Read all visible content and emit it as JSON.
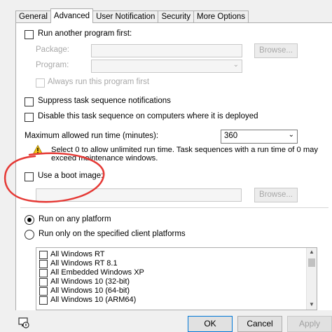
{
  "tabs": [
    "General",
    "Advanced",
    "User Notification",
    "Security",
    "More Options"
  ],
  "run_another": {
    "label": "Run another program first:",
    "package_label": "Package:",
    "program_label": "Program:",
    "always_run_label": "Always run this program first",
    "browse_label": "Browse..."
  },
  "suppress_label": "Suppress task sequence notifications",
  "disable_label": "Disable this task sequence on computers where it is deployed",
  "max_run": {
    "label": "Maximum allowed run time (minutes):",
    "value": "360"
  },
  "warning_text": "Select 0 to allow unlimited run time. Task sequences with a run time of 0 may exceed maintenance windows.",
  "boot_image": {
    "label": "Use a boot image:",
    "browse_label": "Browse..."
  },
  "platform": {
    "any_label": "Run on any platform",
    "specified_label": "Run only on the specified client platforms"
  },
  "platforms": [
    "All Windows RT",
    "All Windows RT 8.1",
    "All Embedded Windows XP",
    "All Windows 10 (32-bit)",
    "All Windows 10 (64-bit)",
    "All Windows 10 (ARM64)"
  ],
  "buttons": {
    "ok": "OK",
    "cancel": "Cancel",
    "apply": "Apply"
  },
  "colors": {
    "annotation": "#e53935",
    "warning": "#f5c518"
  }
}
